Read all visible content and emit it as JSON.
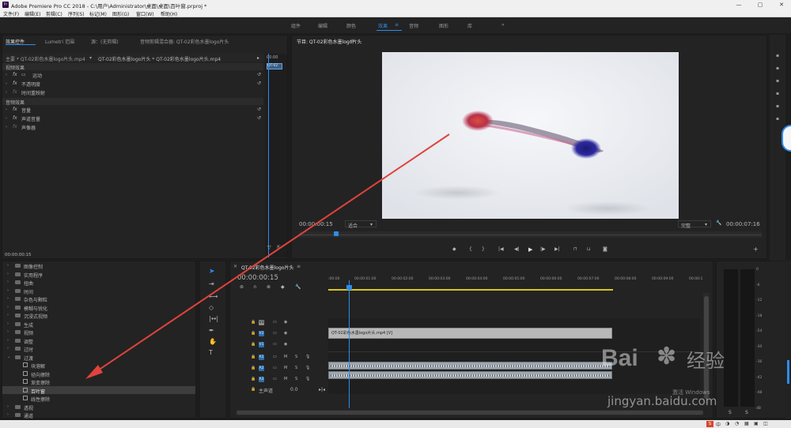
{
  "window": {
    "title": "Adobe Premiere Pro CC 2018 - C:\\用户\\Administrator\\桌面\\桌面\\百叶窗.prproj *",
    "logo": "Pr"
  },
  "menu": [
    "文件(F)",
    "编辑(E)",
    "剪辑(C)",
    "序列(S)",
    "标记(M)",
    "图形(G)",
    "窗口(W)",
    "帮助(H)"
  ],
  "workspaces": {
    "items": [
      "组件",
      "编辑",
      "颜色",
      "效果",
      "音频",
      "图形",
      "库"
    ],
    "active": "效果",
    "menu_icon": "≡",
    "more": "»"
  },
  "effect_controls": {
    "tabs": [
      "效果控件",
      "Lumetri 范围",
      "源：(无剪辑)",
      "音频剪辑混合器: QT-02彩色水墨logo片头"
    ],
    "master": "主要 * QT-02彩色水墨logo片头.mp4",
    "clip": "QT-02彩色水墨logo片头 * QT-02彩色水墨logo片头.mp4",
    "mini_time": "00:00",
    "mini_clip": "QT-02",
    "video_header": "视频效果",
    "video_effects": [
      "运动",
      "不透明度",
      "时间重映射"
    ],
    "audio_header": "音频效果",
    "audio_effects": [
      "音量",
      "声道音量",
      "声像器"
    ],
    "fx_label": "fx",
    "timecode": "00:00:00:15"
  },
  "program": {
    "title": "节目: QT-02彩色水墨logo片头",
    "timecode": "00:00:00:15",
    "fit": "适合",
    "quality": "完整",
    "duration": "00:00:07:16"
  },
  "effects_list": {
    "folders": [
      "图像控制",
      "实用程序",
      "扭曲",
      "时间",
      "杂色与颗粒",
      "模糊与锐化",
      "沉浸式视频",
      "生成",
      "视频",
      "调整",
      "过时",
      "过渡"
    ],
    "transition_items": [
      "块溶解",
      "径向擦除",
      "渐变擦除",
      "百叶窗",
      "线性擦除"
    ],
    "selected": "百叶窗",
    "folders_after": [
      "透视",
      "通道"
    ]
  },
  "timeline": {
    "tab": "QT-02彩色水墨logo片头",
    "timecode": "00:00:00:15",
    "ruler": [
      ":00:00",
      "00:00:01:00",
      "00:00:02:00",
      "00:00:03:00",
      "00:00:04:00",
      "00:00:05:00",
      "00:00:06:00",
      "00:00:07:00",
      "00:00:08:00",
      "00:00:09:00",
      "00:00:1"
    ],
    "video_tracks": [
      "V3",
      "V2",
      "V1"
    ],
    "audio_tracks": [
      "A1",
      "A2",
      "A3"
    ],
    "master": "主声道",
    "master_value": "0.0",
    "video_clip": "QT-02彩色水墨logo片头.mp4 [V]",
    "mute": "M",
    "solo": "S"
  },
  "meter": {
    "scale": [
      "0",
      "-6",
      "-12",
      "-18",
      "-24",
      "-30",
      "-36",
      "-42",
      "-48",
      "dB"
    ],
    "solo": [
      "S",
      "S"
    ]
  },
  "watermark": {
    "brand": "Bai",
    "brand_cn": "经验",
    "url": "jingyan.baidu.com",
    "activate": "激活 Windows"
  },
  "taskbar": {
    "ime": "S",
    "ime_text": "中"
  },
  "colors": {
    "accent": "#2d8ceb",
    "annotation": "#e0433d",
    "playhead": "#2d8ceb"
  }
}
